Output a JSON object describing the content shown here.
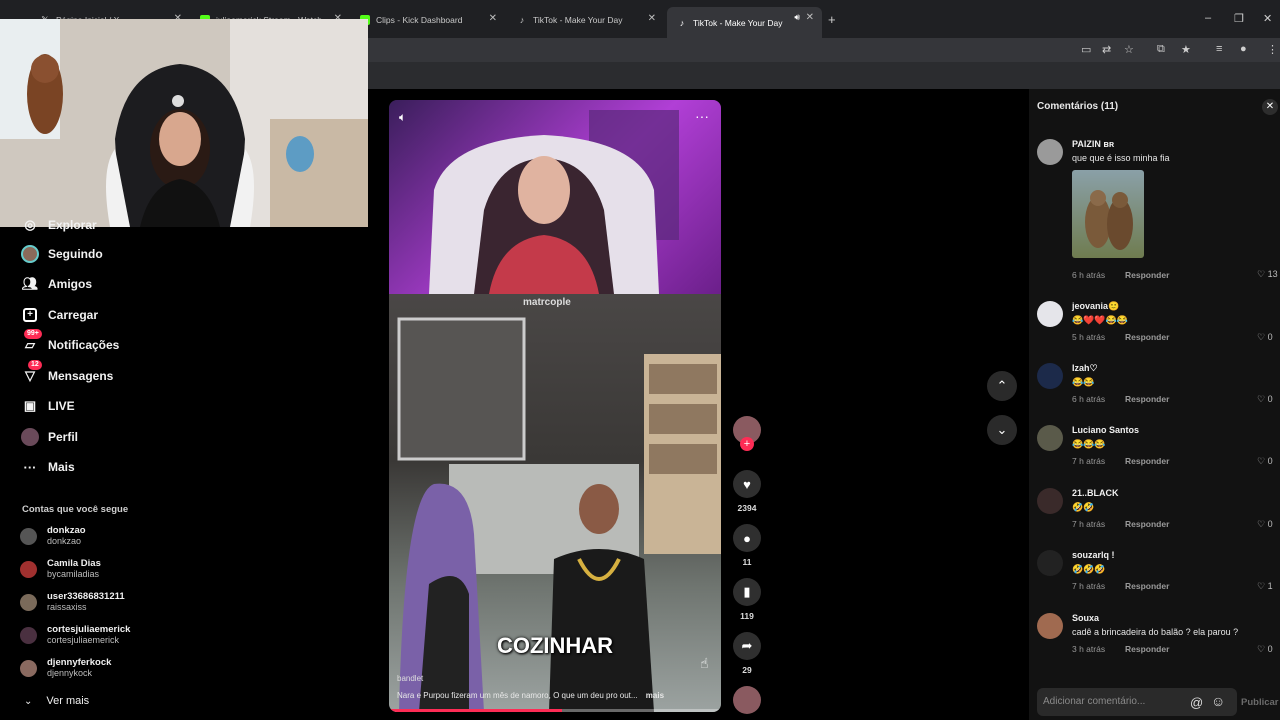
{
  "browser": {
    "tabs": [
      {
        "title": "Página Inicial / X",
        "favicon": "x-logo"
      },
      {
        "title": "juliaemerick Stream - Watch",
        "favicon": "kick-logo"
      },
      {
        "title": "Clips - Kick Dashboard",
        "favicon": "kick-logo"
      },
      {
        "title": "TikTok - Make Your Day",
        "favicon": "tiktok-logo"
      },
      {
        "title": "TikTok - Make Your Day",
        "favicon": "tiktok-logo"
      }
    ],
    "new_tab": "+",
    "window_controls": [
      "–",
      "❐",
      "✕"
    ]
  },
  "sidebar": {
    "items": [
      {
        "label": "Explorar",
        "icon": "compass-icon"
      },
      {
        "label": "Seguindo",
        "icon": "following-avatar-icon"
      },
      {
        "label": "Amigos",
        "icon": "friends-icon"
      },
      {
        "label": "Carregar",
        "icon": "upload-plus-icon"
      },
      {
        "label": "Notificações",
        "icon": "inbox-icon",
        "badge": "99+"
      },
      {
        "label": "Mensagens",
        "icon": "send-icon",
        "badge": "12"
      },
      {
        "label": "LIVE",
        "icon": "live-tv-icon"
      },
      {
        "label": "Perfil",
        "icon": "profile-avatar-icon"
      },
      {
        "label": "Mais",
        "icon": "more-dots-icon"
      }
    ],
    "following_title": "Contas que você segue",
    "accounts": [
      {
        "name": "donkzao",
        "handle": "donkzao"
      },
      {
        "name": "Camila Dias",
        "handle": "bycamiladias"
      },
      {
        "name": "user33686831211",
        "handle": "raissaxiss"
      },
      {
        "name": "cortesjuliaemerick",
        "handle": "cortesjuliaemerick"
      },
      {
        "name": "djennyferkock",
        "handle": "djennykock"
      }
    ],
    "see_more": "Ver mais"
  },
  "video": {
    "watermark": "matrcople",
    "caption": "COZINHAR",
    "username": "bandlet",
    "description": "Nara e Purpou fizeram um mês de namoro, O que um deu pro out...",
    "more": "mais",
    "progress": 0.52,
    "likes": "2394",
    "comments_count": "11",
    "saves": "119",
    "shares": "29"
  },
  "comments": {
    "title": "Comentários (11)",
    "input_placeholder": "Adicionar comentário...",
    "publish": "Publicar",
    "reply_label": "Responder",
    "items": [
      {
        "user": "PAIZIN ʙʀ",
        "text": "que que é isso minha fia",
        "time": "6 h atrás",
        "likes": "13",
        "has_image": true
      },
      {
        "user": "jeovania🙂",
        "text": "😂❤️❤️😂😂",
        "time": "5 h atrás",
        "likes": "0"
      },
      {
        "user": "Izah♡",
        "text": "😂😂",
        "time": "6 h atrás",
        "likes": "0"
      },
      {
        "user": "Luciano Santos",
        "text": "😂😂😂",
        "time": "7 h atrás",
        "likes": "0"
      },
      {
        "user": "21..BLACK",
        "text": "🤣🤣",
        "time": "7 h atrás",
        "likes": "0"
      },
      {
        "user": "souzarlq !",
        "text": "🤣🤣🤣",
        "time": "7 h atrás",
        "likes": "1"
      },
      {
        "user": "Souxa",
        "text": "cadê a brincadeira do balão ? ela parou ?",
        "time": "3 h atrás",
        "likes": "0"
      }
    ]
  },
  "colors": {
    "accent": "#fe2c55",
    "panel": "#121212"
  }
}
